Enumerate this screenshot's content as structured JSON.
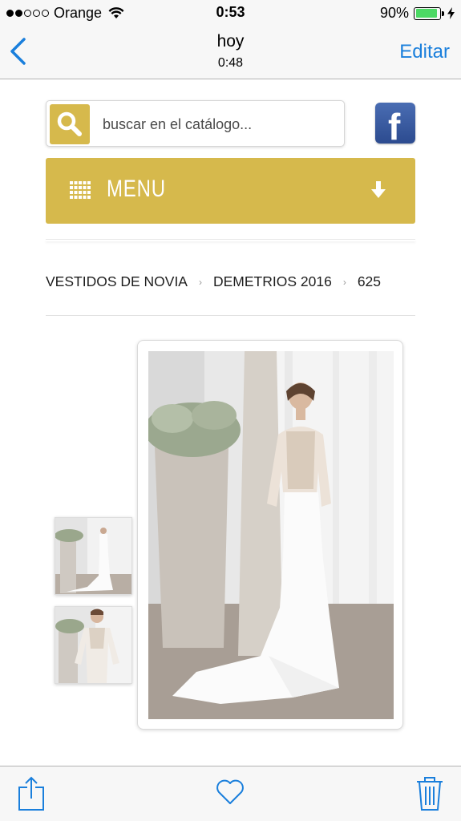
{
  "status_bar": {
    "carrier": "Orange",
    "time": "0:53",
    "battery": "90%",
    "battery_level": 0.9,
    "signal_bars_filled": 2,
    "signal_bars_total": 5
  },
  "nav": {
    "back_icon": "chevron-left-icon",
    "title": "hoy",
    "subtitle": "0:48",
    "edit_label": "Editar"
  },
  "search": {
    "placeholder": "buscar en el catálogo...",
    "value": "",
    "icon": "search-icon"
  },
  "facebook": {
    "icon": "facebook-icon"
  },
  "menu": {
    "label": "MENU",
    "grid_icon": "grid-icon",
    "arrow_icon": "arrow-down-icon"
  },
  "breadcrumb": {
    "items": [
      "VESTIDOS DE NOVIA",
      "DEMETRIOS 2016",
      "625"
    ],
    "separator": "›"
  },
  "gallery": {
    "thumbnails": [
      "wedding-dress-full-view",
      "wedding-dress-closeup"
    ],
    "main_image": "wedding-dress-full-view"
  },
  "toolbar": {
    "share_icon": "share-icon",
    "favorite_icon": "heart-icon",
    "trash_icon": "trash-icon"
  },
  "colors": {
    "accent_gold": "#d6b94c",
    "ios_blue": "#1a7fdc",
    "facebook_blue": "#3b5998",
    "battery_green": "#4cd964"
  }
}
